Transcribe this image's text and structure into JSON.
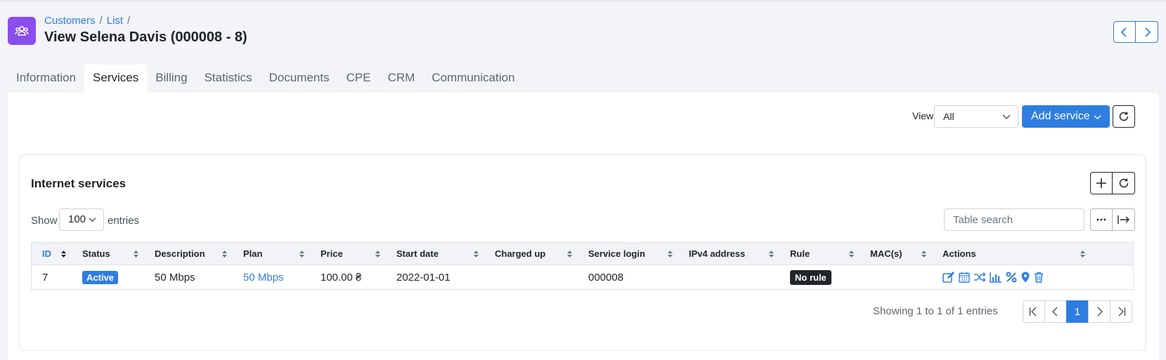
{
  "breadcrumb": {
    "items": [
      "Customers",
      "List"
    ]
  },
  "page": {
    "title": "View Selena Davis (000008 - 8)"
  },
  "tabs": [
    {
      "label": "Information",
      "active": false
    },
    {
      "label": "Services",
      "active": true
    },
    {
      "label": "Billing",
      "active": false
    },
    {
      "label": "Statistics",
      "active": false
    },
    {
      "label": "Documents",
      "active": false
    },
    {
      "label": "CPE",
      "active": false
    },
    {
      "label": "CRM",
      "active": false
    },
    {
      "label": "Communication",
      "active": false
    }
  ],
  "toolbar": {
    "view_label": "View",
    "view_value": "All",
    "add_service_label": "Add service"
  },
  "section": {
    "title": "Internet services"
  },
  "table_controls": {
    "show_label": "Show",
    "show_value": "100",
    "entries_label": "entries",
    "search_placeholder": "Table search"
  },
  "table": {
    "columns": [
      "ID",
      "Status",
      "Description",
      "Plan",
      "Price",
      "Start date",
      "Charged up",
      "Service login",
      "IPv4 address",
      "Rule",
      "MAC(s)",
      "Actions"
    ],
    "rows": [
      {
        "id": "7",
        "status": "Active",
        "description": "50 Mbps",
        "plan": "50 Mbps",
        "price": "100.00 ₴",
        "start_date": "2022-01-01",
        "charged_up": "",
        "service_login": "000008",
        "ipv4": "",
        "rule": "No rule",
        "macs": ""
      }
    ],
    "action_icons": [
      "edit-icon",
      "calendar-icon",
      "shuffle-icon",
      "bar-chart-icon",
      "percent-icon",
      "map-pin-icon",
      "trash-icon"
    ]
  },
  "pagination": {
    "summary": "Showing 1 to 1 of 1 entries",
    "current_page": "1"
  },
  "colors": {
    "accent": "#2f7de1",
    "header_icon_bg": "#8a4dee",
    "rule_badge": "#212529"
  }
}
